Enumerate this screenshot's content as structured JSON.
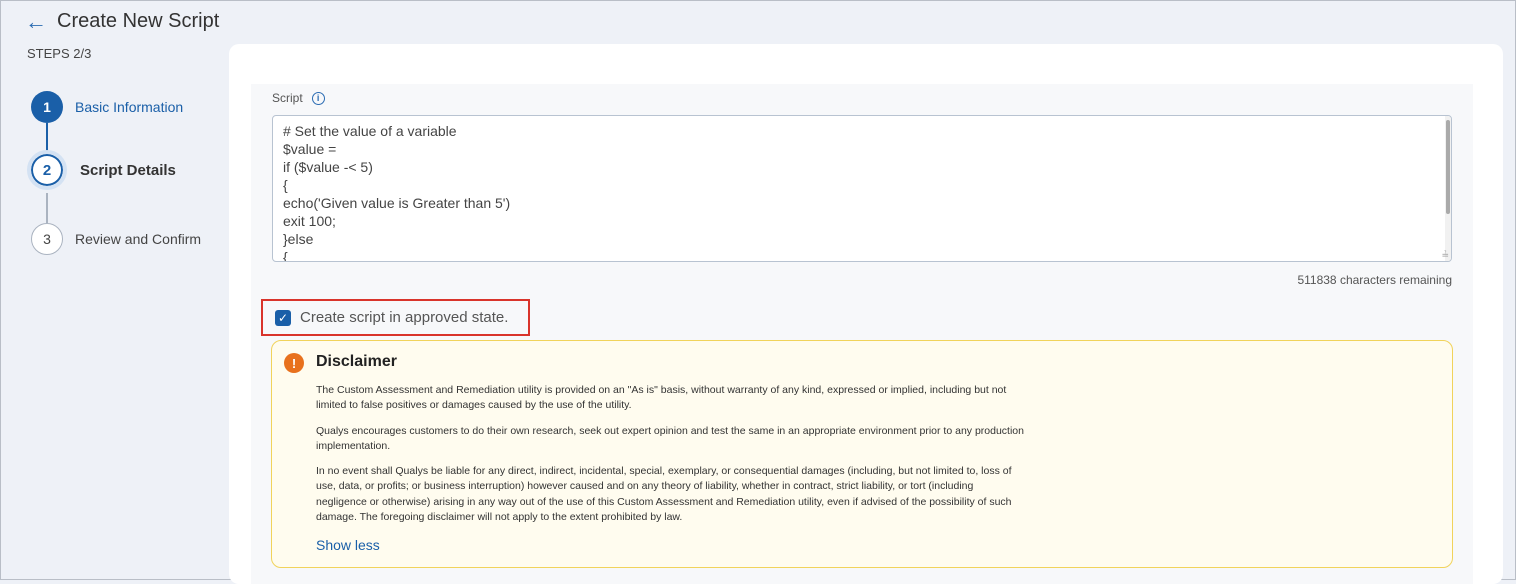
{
  "header": {
    "title": "Create New Script",
    "back_icon": "arrow-left-icon"
  },
  "steps": {
    "label": "STEPS 2/3",
    "items": [
      {
        "number": "1",
        "label": "Basic Information",
        "state": "completed"
      },
      {
        "number": "2",
        "label": "Script Details",
        "state": "active"
      },
      {
        "number": "3",
        "label": "Review and Confirm",
        "state": "pending"
      }
    ]
  },
  "script": {
    "label": "Script",
    "info_icon": "info-icon",
    "content": "# Set the value of a variable\n$value =\nif ($value -< 5)\n{\necho('Given value is Greater than 5')\nexit 100;\n}else\n{",
    "chars_remaining": "511838 characters remaining"
  },
  "approve": {
    "label": "Create script in approved state.",
    "checked": true
  },
  "disclaimer": {
    "title": "Disclaimer",
    "icon": "warning-icon",
    "paragraphs": [
      "The Custom Assessment and Remediation utility is provided on an \"As is\" basis, without warranty of any kind, expressed or implied, including but not limited to false positives or damages caused by the use of the utility.",
      "Qualys encourages customers to do their own research, seek out expert opinion and test the same in an appropriate environment prior to any production implementation.",
      "In no event shall Qualys be liable for any direct, indirect, incidental, special, exemplary, or consequential damages (including, but not limited to, loss of use, data, or profits; or business interruption) however caused and on any theory of liability, whether in contract, strict liability, or tort (including negligence or otherwise) arising in any way out of the use of this Custom Assessment and Remediation utility, even if advised of the possibility of such damage. The foregoing disclaimer will not apply to the extent prohibited by law."
    ],
    "toggle_label": "Show less"
  },
  "colors": {
    "primary": "#1a5fa8",
    "highlight_border": "#d9342b",
    "warning": "#e8711d",
    "disclaimer_bg": "#fffcef"
  }
}
